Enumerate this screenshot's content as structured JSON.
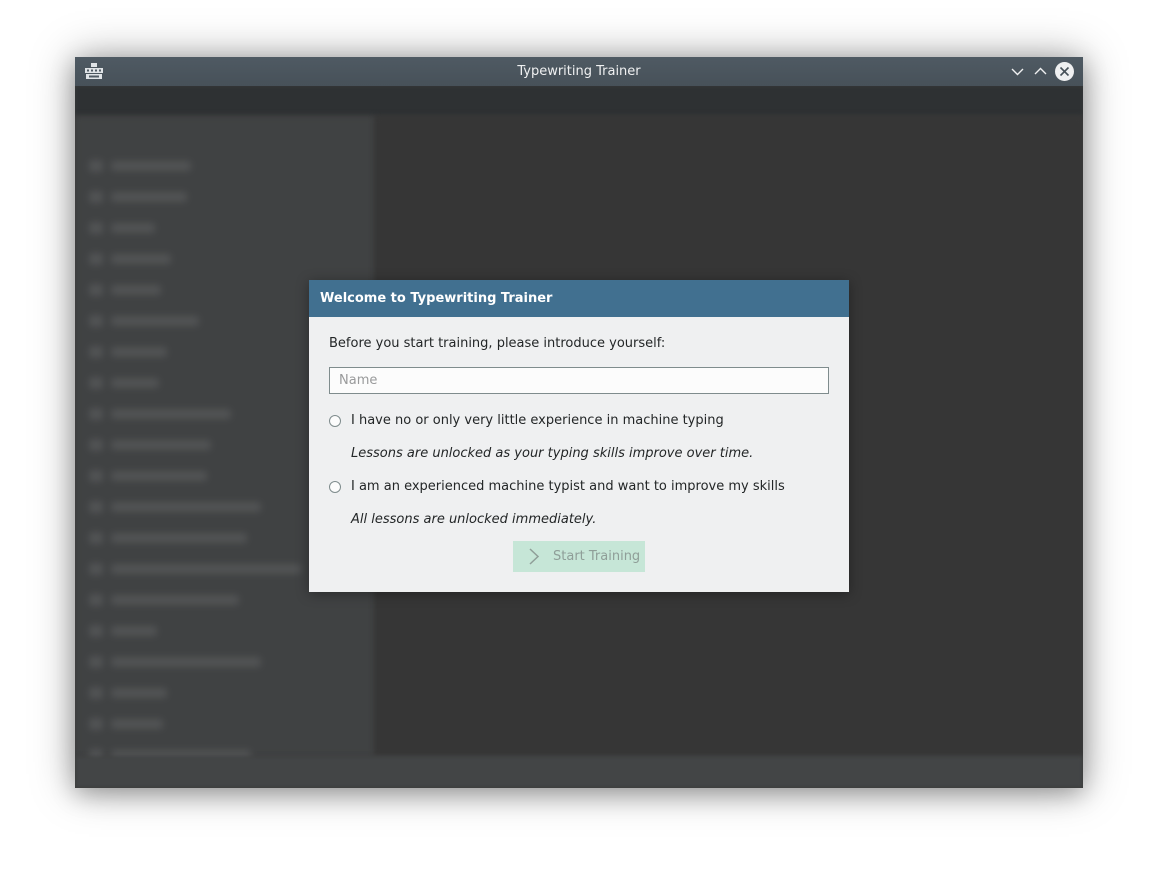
{
  "window": {
    "title": "Typewriting Trainer",
    "app_icon": "typewriter-app-icon",
    "controls": [
      "minimize-icon",
      "maximize-icon",
      "close-icon"
    ]
  },
  "dialog": {
    "title": "Welcome to Typewriting Trainer",
    "intro": "Before you start training, please introduce yourself:",
    "name_field": {
      "value": "",
      "placeholder": "Name"
    },
    "options": [
      {
        "label": "I have no or only very little experience in machine typing",
        "description": "Lessons are unlocked as your typing skills improve over time.",
        "selected": false
      },
      {
        "label": "I am an experienced machine typist and want to improve my skills",
        "description": "All lessons are unlocked immediately.",
        "selected": false
      }
    ],
    "start_button": {
      "label": "Start Training",
      "icon": "chevron-right-icon",
      "enabled": false
    }
  },
  "colors": {
    "titlebar": "#4f5a63",
    "dialog_header": "#417090",
    "dialog_background": "#eff0f1",
    "start_button_disabled": "#c6e6d7"
  }
}
